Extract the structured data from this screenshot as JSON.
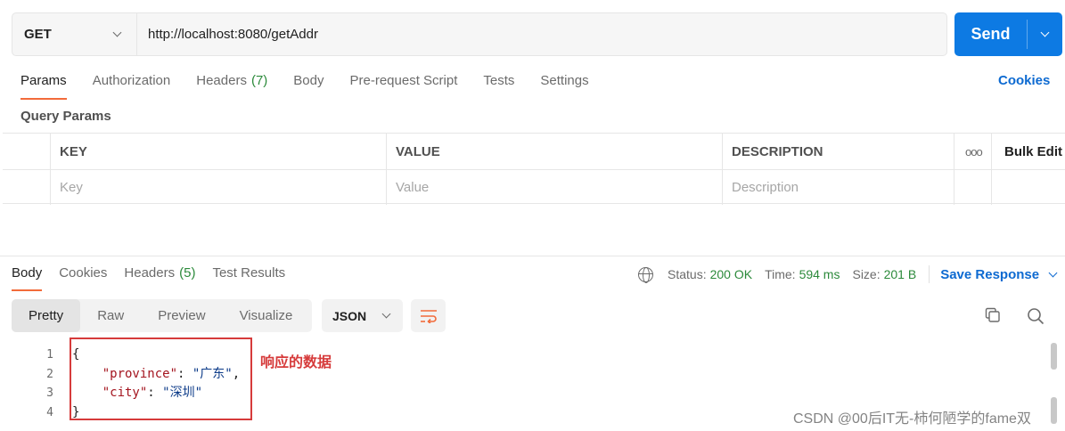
{
  "request": {
    "method": "GET",
    "url": "http://localhost:8080/getAddr",
    "send_label": "Send"
  },
  "request_tabs": {
    "params": "Params",
    "authorization": "Authorization",
    "headers": "Headers",
    "headers_count": "(7)",
    "body": "Body",
    "prerequest": "Pre-request Script",
    "tests": "Tests",
    "settings": "Settings"
  },
  "cookies_link": "Cookies",
  "query_params": {
    "title": "Query Params",
    "headers": {
      "key": "KEY",
      "value": "VALUE",
      "description": "DESCRIPTION",
      "bulk_edit": "Bulk Edit",
      "more": "ooo"
    },
    "placeholders": {
      "key": "Key",
      "value": "Value",
      "description": "Description"
    }
  },
  "response_tabs": {
    "body": "Body",
    "cookies": "Cookies",
    "headers": "Headers",
    "headers_count": "(5)",
    "test_results": "Test Results"
  },
  "response_status": {
    "status_label": "Status:",
    "status_value": "200 OK",
    "time_label": "Time:",
    "time_value": "594 ms",
    "size_label": "Size:",
    "size_value": "201 B",
    "save_response": "Save Response"
  },
  "view_modes": {
    "pretty": "Pretty",
    "raw": "Raw",
    "preview": "Preview",
    "visualize": "Visualize"
  },
  "format": "JSON",
  "code": {
    "line_numbers": [
      "1",
      "2",
      "3",
      "4"
    ],
    "open_brace": "{",
    "province_key": "\"province\"",
    "province_value": "\"广东\"",
    "city_key": "\"city\"",
    "city_value": "\"深圳\"",
    "close_brace": "}"
  },
  "annotation": "响应的数据",
  "watermark": "CSDN @00后IT无-柿何陋学的fame双",
  "colors": {
    "send": "#0d7ae3",
    "accent_tab": "#f26b3a",
    "status_ok": "#2c8a3b",
    "link": "#0d6ad1",
    "annotation": "#d63b3b"
  }
}
